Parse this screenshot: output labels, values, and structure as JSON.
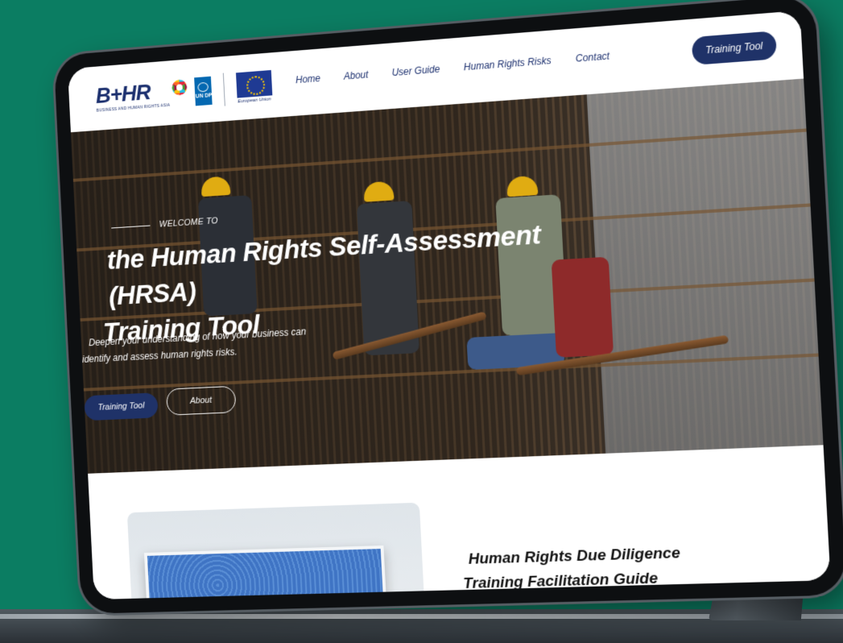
{
  "nav": {
    "logo_text": "B+HR",
    "logo_subtitle": "BUSINESS AND HUMAN RIGHTS ASIA",
    "undp_text": "UN DP",
    "eu_label": "European Union",
    "links": [
      "Home",
      "About",
      "User Guide",
      "Human Rights Risks",
      "Contact"
    ],
    "cta_label": "Training Tool"
  },
  "hero": {
    "eyebrow": "WELCOME TO",
    "title_line1": "the Human Rights Self-Assessment (HRSA)",
    "title_line2": "Training Tool",
    "subtitle_line1": "Deepen your understanding of how your business can",
    "subtitle_line2": "identify and assess human rights risks.",
    "primary_button": "Training Tool",
    "secondary_button": "About"
  },
  "section": {
    "title_line1": "Human Rights Due Diligence",
    "title_line2": "Training Facilitation Guide"
  },
  "colors": {
    "background": "#0b7d62",
    "brand_navy": "#1f3268",
    "hard_hat": "#e0ac12"
  }
}
